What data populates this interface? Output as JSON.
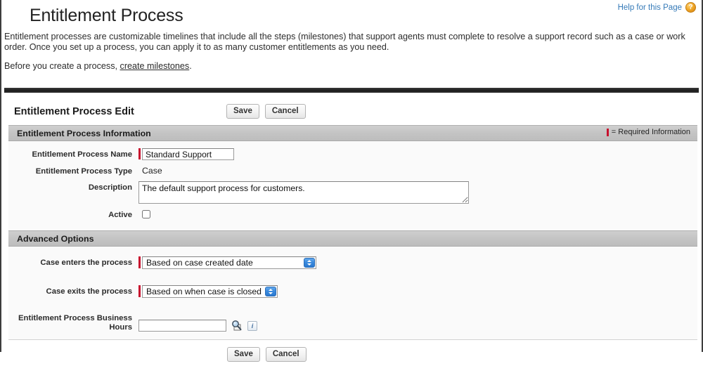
{
  "header": {
    "page_title": "Entitlement Process",
    "help_link": "Help for this Page",
    "help_icon": "question-mark-icon",
    "help_icon_glyph": "?"
  },
  "intro": {
    "paragraph1": "Entitlement processes are customizable timelines that include all the steps (milestones) that support agents must complete to resolve a support record such as a case or work order. Once you set up a process, you can apply it to as many customer entitlements as you need.",
    "paragraph2_prefix": "Before you create a process, ",
    "paragraph2_link": "create milestones",
    "paragraph2_suffix": "."
  },
  "panel": {
    "title": "Entitlement Process Edit",
    "save_label": "Save",
    "cancel_label": "Cancel"
  },
  "sections": {
    "information": {
      "heading": "Entitlement Process Information",
      "required_legend": "= Required Information",
      "fields": {
        "name_label": "Entitlement Process Name",
        "name_value": "Standard Support",
        "type_label": "Entitlement Process Type",
        "type_value": "Case",
        "description_label": "Description",
        "description_value": "The default support process for customers.",
        "active_label": "Active",
        "active_checked": false
      }
    },
    "advanced": {
      "heading": "Advanced Options",
      "fields": {
        "enters_label": "Case enters the process",
        "enters_value": "Based on case created date",
        "exits_label": "Case exits the process",
        "exits_value": "Based on when case is closed",
        "business_hours_label_line1": "Entitlement Process Business",
        "business_hours_label_line2": "Hours",
        "business_hours_value": "",
        "lookup_icon": "magnifier-lookup-icon",
        "info_icon": "info-icon",
        "info_icon_glyph": "i"
      }
    }
  },
  "colors": {
    "required_marker": "#c8102e",
    "link": "#357ab8",
    "section_header_bg": "#c4c4c4",
    "stepper_blue": "#3a8ade",
    "help_icon_orange": "#f0a828"
  }
}
